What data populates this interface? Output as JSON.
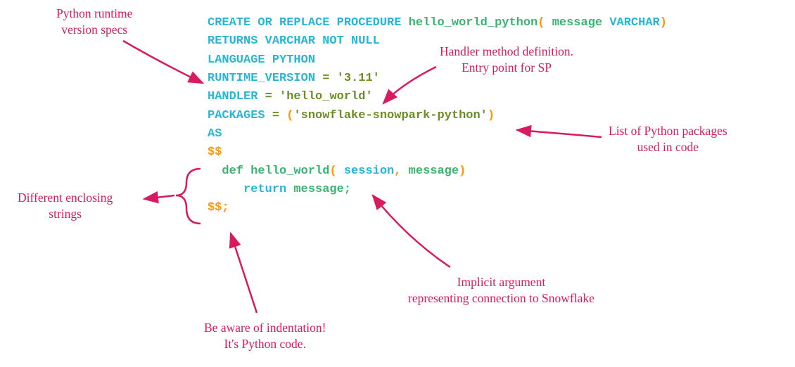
{
  "code": {
    "l1_create": "CREATE OR REPLACE PROCEDURE ",
    "l1_name": "hello_world_python",
    "l1_open": "(",
    "l1_arg": " message ",
    "l1_type": "VARCHAR",
    "l1_close": ")",
    "l2": "RETURNS VARCHAR NOT NULL",
    "l3": "LANGUAGE PYTHON",
    "l4_key": "RUNTIME_VERSION",
    "l4_eq": " = ",
    "l4_val": "'3.11'",
    "l5_key": "HANDLER",
    "l5_eq": " = ",
    "l5_val": "'hello_world'",
    "l6_key": "PACKAGES",
    "l6_eq": " = ",
    "l6_open": "(",
    "l6_val": "'snowflake-snowpark-python'",
    "l6_close": ")",
    "l7": "AS",
    "l8": "$$",
    "l9_def": "  def ",
    "l9_name": "hello_world",
    "l9_open": "(",
    "l9_sess": " session",
    "l9_comma": ",",
    "l9_msg": " message",
    "l9_close": ")",
    "l10_ret": "     return ",
    "l10_val": "message;",
    "l11": "$$;"
  },
  "annotations": {
    "runtime": "Python runtime\nversion specs",
    "handler": "Handler method definition.\nEntry point for SP",
    "packages": "List of Python packages\nused in code",
    "enclosing": "Different enclosing\nstrings",
    "indentation": "Be aware of indentation!\nIt's Python code.",
    "implicit": "Implicit argument\nrepresenting connection to Snowflake"
  }
}
